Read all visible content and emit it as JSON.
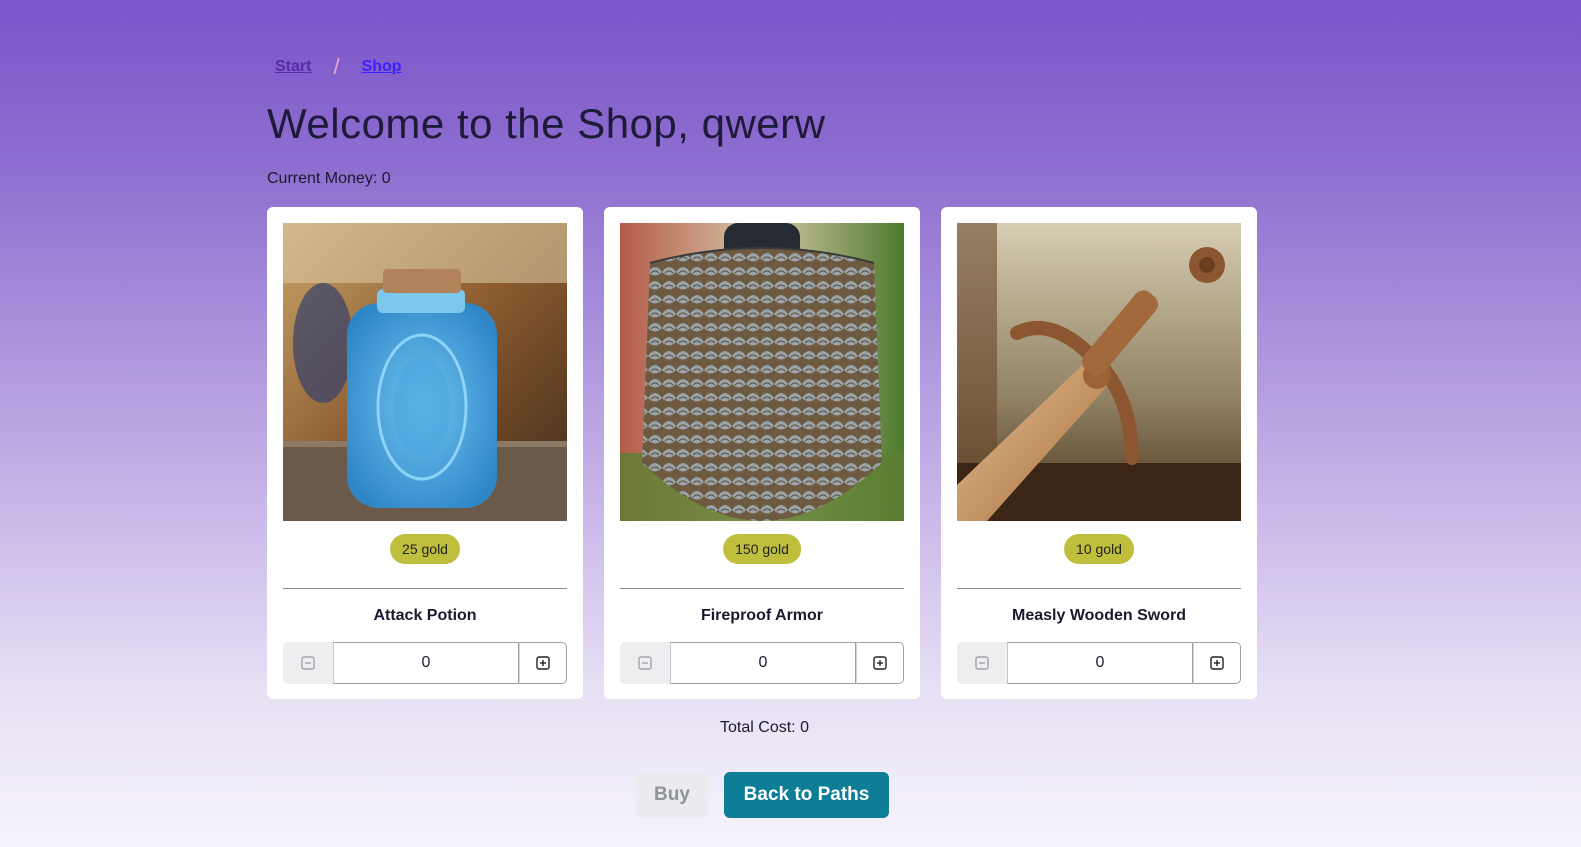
{
  "breadcrumb": {
    "start": "Start",
    "separator": "/",
    "shop": "Shop"
  },
  "page_title": "Welcome to the Shop, qwerw",
  "money": {
    "text": "Current Money: 0"
  },
  "items": [
    {
      "name": "Attack Potion",
      "price": "25 gold",
      "quantity": "0",
      "image": "blue-glass-potion-bottle"
    },
    {
      "name": "Fireproof Armor",
      "price": "150 gold",
      "quantity": "0",
      "image": "scale-mail-armor-on-mannequin"
    },
    {
      "name": "Measly Wooden Sword",
      "price": "10 gold",
      "quantity": "0",
      "image": "wooden-sword"
    }
  ],
  "total": {
    "text": "Total Cost: 0"
  },
  "actions": {
    "buy": "Buy",
    "back": "Back to Paths"
  },
  "colors": {
    "accent": "#0d7e96",
    "price_badge": "#bfbf3d",
    "bg_top": "#7b55c9"
  }
}
